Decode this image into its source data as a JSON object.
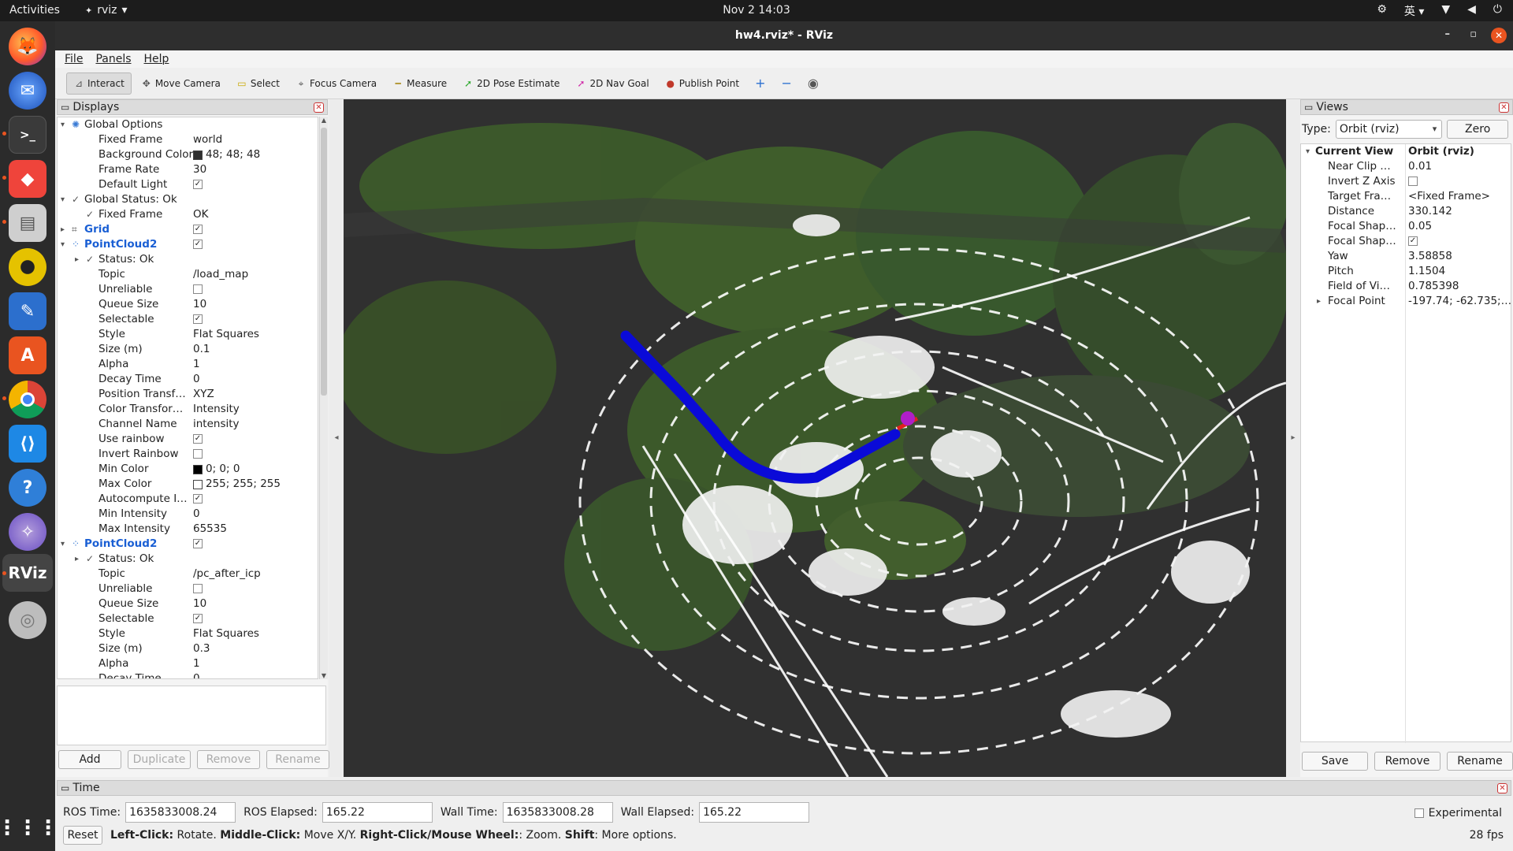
{
  "topbar": {
    "activities": "Activities",
    "app_name": "rviz",
    "app_menu_arrow": "▾",
    "clock": "Nov 2  14:03",
    "input_method": "英 ▾",
    "tray_icons": [
      "network-icon",
      "wifi-icon",
      "volume-icon",
      "power-icon"
    ]
  },
  "dock": {
    "items": [
      "firefox",
      "thunderbird",
      "terminal",
      "anydesk",
      "files",
      "rhythmbox",
      "libreoffice-writer",
      "ubuntu-software",
      "chrome",
      "vscode",
      "help",
      "purple-app",
      "rviz",
      "disk",
      "app-grid"
    ],
    "rviz_label": "RViz"
  },
  "window": {
    "title": "hw4.rviz* - RViz",
    "minimize": "–",
    "maximize": "▫",
    "close": "✕"
  },
  "menu": [
    "File",
    "Panels",
    "Help"
  ],
  "toolbar": [
    {
      "label": "Interact",
      "icon": "interact-icon",
      "glyph": "⊿",
      "color": "#555"
    },
    {
      "label": "Move Camera",
      "icon": "move-camera-icon",
      "glyph": "✥",
      "color": "#555"
    },
    {
      "label": "Select",
      "icon": "select-icon",
      "glyph": "▭",
      "color": "#c9a800"
    },
    {
      "label": "Focus Camera",
      "icon": "focus-camera-icon",
      "glyph": "⌖",
      "color": "#555"
    },
    {
      "label": "Measure",
      "icon": "measure-icon",
      "glyph": "━",
      "color": "#b59a3c"
    },
    {
      "label": "2D Pose Estimate",
      "icon": "pose-estimate-icon",
      "glyph": "➚",
      "color": "#2aa82a"
    },
    {
      "label": "2D Nav Goal",
      "icon": "nav-goal-icon",
      "glyph": "➚",
      "color": "#d02aa8"
    },
    {
      "label": "Publish Point",
      "icon": "publish-point-icon",
      "glyph": "●",
      "color": "#c0392b"
    }
  ],
  "toolbar_extra": {
    "plus": "+",
    "minus": "−",
    "eye": "◉"
  },
  "displays": {
    "title": "Displays",
    "rows": [
      {
        "depth": 0,
        "arrow": "▾",
        "icon": "gear",
        "key": "Global Options",
        "value": ""
      },
      {
        "depth": 1,
        "key": "Fixed Frame",
        "value": "world"
      },
      {
        "depth": 1,
        "key": "Background Color",
        "value": "48; 48; 48",
        "swatch": "#303030"
      },
      {
        "depth": 1,
        "key": "Frame Rate",
        "value": "30"
      },
      {
        "depth": 1,
        "key": "Default Light",
        "check": true
      },
      {
        "depth": 0,
        "arrow": "▾",
        "tick": true,
        "key": "Global Status: Ok",
        "value": ""
      },
      {
        "depth": 1,
        "tick": true,
        "key": "Fixed Frame",
        "value": "OK"
      },
      {
        "depth": 0,
        "arrow": "▸",
        "icon": "grid",
        "key": "Grid",
        "blue": true,
        "check": true
      },
      {
        "depth": 0,
        "arrow": "▾",
        "icon": "cloud",
        "key": "PointCloud2",
        "blue": true,
        "check": true
      },
      {
        "depth": 1,
        "arrow": "▸",
        "tick": true,
        "key": "Status: Ok",
        "value": ""
      },
      {
        "depth": 1,
        "key": "Topic",
        "value": "/load_map"
      },
      {
        "depth": 1,
        "key": "Unreliable",
        "check": false
      },
      {
        "depth": 1,
        "key": "Queue Size",
        "value": "10"
      },
      {
        "depth": 1,
        "key": "Selectable",
        "check": true
      },
      {
        "depth": 1,
        "key": "Style",
        "value": "Flat Squares"
      },
      {
        "depth": 1,
        "key": "Size (m)",
        "value": "0.1"
      },
      {
        "depth": 1,
        "key": "Alpha",
        "value": "1"
      },
      {
        "depth": 1,
        "key": "Decay Time",
        "value": "0"
      },
      {
        "depth": 1,
        "key": "Position Transf…",
        "value": "XYZ"
      },
      {
        "depth": 1,
        "key": "Color Transfor…",
        "value": "Intensity"
      },
      {
        "depth": 1,
        "key": "Channel Name",
        "value": "intensity"
      },
      {
        "depth": 1,
        "key": "Use rainbow",
        "check": true
      },
      {
        "depth": 1,
        "key": "Invert Rainbow",
        "check": false
      },
      {
        "depth": 1,
        "key": "Min Color",
        "value": "0; 0; 0",
        "swatch": "#000000"
      },
      {
        "depth": 1,
        "key": "Max Color",
        "value": "255; 255; 255",
        "swatch": "#ffffff"
      },
      {
        "depth": 1,
        "key": "Autocompute I…",
        "check": true
      },
      {
        "depth": 1,
        "key": "Min Intensity",
        "value": "0"
      },
      {
        "depth": 1,
        "key": "Max Intensity",
        "value": "65535"
      },
      {
        "depth": 0,
        "arrow": "▾",
        "icon": "cloud",
        "key": "PointCloud2",
        "blue": true,
        "check": true
      },
      {
        "depth": 1,
        "arrow": "▸",
        "tick": true,
        "key": "Status: Ok",
        "value": ""
      },
      {
        "depth": 1,
        "key": "Topic",
        "value": "/pc_after_icp"
      },
      {
        "depth": 1,
        "key": "Unreliable",
        "check": false
      },
      {
        "depth": 1,
        "key": "Queue Size",
        "value": "10"
      },
      {
        "depth": 1,
        "key": "Selectable",
        "check": true
      },
      {
        "depth": 1,
        "key": "Style",
        "value": "Flat Squares"
      },
      {
        "depth": 1,
        "key": "Size (m)",
        "value": "0.3"
      },
      {
        "depth": 1,
        "key": "Alpha",
        "value": "1"
      },
      {
        "depth": 1,
        "key": "Decay Time",
        "value": "0"
      }
    ],
    "buttons": {
      "add": "Add",
      "duplicate": "Duplicate",
      "remove": "Remove",
      "rename": "Rename"
    }
  },
  "views": {
    "title": "Views",
    "type_label": "Type:",
    "type_value": "Orbit (rviz)",
    "zero": "Zero",
    "rows": [
      {
        "arrow": "▾",
        "key": "Current View",
        "value": "Orbit (rviz)",
        "bold": true
      },
      {
        "key": "Near Clip …",
        "value": "0.01"
      },
      {
        "key": "Invert Z Axis",
        "check": false
      },
      {
        "key": "Target Fra…",
        "value": "<Fixed Frame>"
      },
      {
        "key": "Distance",
        "value": "330.142"
      },
      {
        "key": "Focal Shap…",
        "value": "0.05"
      },
      {
        "key": "Focal Shap…",
        "check": true
      },
      {
        "key": "Yaw",
        "value": "3.58858"
      },
      {
        "key": "Pitch",
        "value": "1.1504"
      },
      {
        "key": "Field of Vi…",
        "value": "0.785398"
      },
      {
        "arrow": "▸",
        "key": "Focal Point",
        "value": "-197.74; -62.735;…"
      }
    ],
    "buttons": {
      "save": "Save",
      "remove": "Remove",
      "rename": "Rename"
    }
  },
  "time": {
    "title": "Time",
    "ros_time_label": "ROS Time:",
    "ros_time": "1635833008.24",
    "ros_elapsed_label": "ROS Elapsed:",
    "ros_elapsed": "165.22",
    "wall_time_label": "Wall Time:",
    "wall_time": "1635833008.28",
    "wall_elapsed_label": "Wall Elapsed:",
    "wall_elapsed": "165.22",
    "experimental": "Experimental"
  },
  "status": {
    "reset": "Reset",
    "hint_b1": "Left-Click:",
    "hint_t1": " Rotate. ",
    "hint_b2": "Middle-Click:",
    "hint_t2": " Move X/Y. ",
    "hint_b3": "Right-Click/Mouse Wheel:",
    "hint_t3": ": Zoom. ",
    "hint_b4": "Shift",
    "hint_t4": ": More options.",
    "fps": "28 fps"
  },
  "colors": {
    "background": "#303030",
    "trajectory": "#0a0ad8",
    "robot_marker": "#b01ec8",
    "accent": "#e95420"
  }
}
